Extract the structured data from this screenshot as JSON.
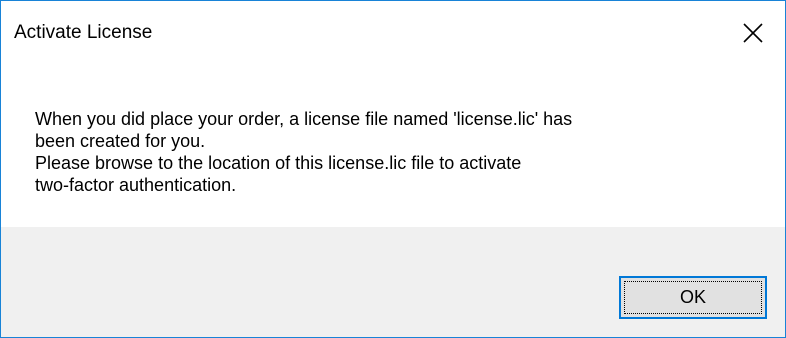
{
  "dialog": {
    "title": "Activate License",
    "close_icon": "close-icon",
    "accent_color": "#0078d7",
    "message_lines": [
      "When you did place your order, a license file named 'license.lic' has",
      "been created for you.",
      "Please browse to the location of this license.lic file to activate",
      "two-factor authentication."
    ],
    "buttons": {
      "ok_label": "OK"
    }
  }
}
